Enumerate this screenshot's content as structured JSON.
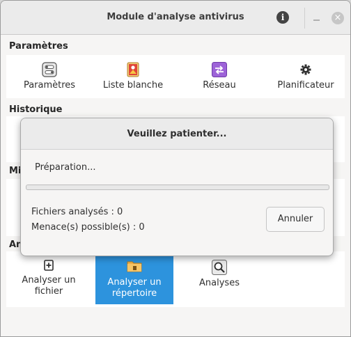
{
  "window": {
    "title": "Module d'analyse antivirus",
    "info_glyph": "i",
    "close_glyph": "×"
  },
  "sections": {
    "parametres": {
      "header": "Paramètres",
      "tools": [
        {
          "label": "Paramètres",
          "icon": "toggle-settings-icon"
        },
        {
          "label": "Liste blanche",
          "icon": "whitelist-icon"
        },
        {
          "label": "Réseau",
          "icon": "network-icon"
        },
        {
          "label": "Planificateur",
          "icon": "gear-icon"
        }
      ]
    },
    "historique": {
      "header": "Historique"
    },
    "mises_a_jour": {
      "header_partial": "Mi"
    },
    "analyse": {
      "header_partial": "An",
      "tools": [
        {
          "label_line1": "Analyser un",
          "label_line2": "fichier",
          "icon": "add-file-icon"
        },
        {
          "label_line1": "Analyser un",
          "label_line2": "répertoire",
          "icon": "folder-icon",
          "selected": true
        },
        {
          "label": "Analyses",
          "icon": "magnifier-icon"
        }
      ]
    }
  },
  "dialog": {
    "title": "Veuillez patienter...",
    "status": "Préparation...",
    "progress": 0,
    "files_scanned": "Fichiers analysés : 0",
    "threats_found": "Menace(s) possible(s) : 0",
    "cancel_label": "Annuler"
  },
  "colors": {
    "accent": "#2d93dd",
    "progress": "#3584e4"
  }
}
